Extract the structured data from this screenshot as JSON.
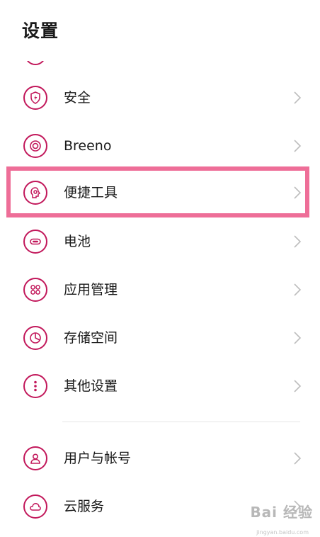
{
  "header": {
    "title": "设置"
  },
  "accent_color": "#c2185b",
  "highlight_color": "#ee6e98",
  "items": [
    {
      "label": "安全",
      "icon": "shield-icon"
    },
    {
      "label": "Breeno",
      "icon": "breeno-icon"
    },
    {
      "label": "便捷工具",
      "icon": "convenience-tools-icon"
    },
    {
      "label": "电池",
      "icon": "battery-icon"
    },
    {
      "label": "应用管理",
      "icon": "app-management-icon"
    },
    {
      "label": "存储空间",
      "icon": "storage-icon"
    },
    {
      "label": "其他设置",
      "icon": "more-settings-icon"
    },
    {
      "label": "用户与帐号",
      "icon": "user-account-icon"
    },
    {
      "label": "云服务",
      "icon": "cloud-icon"
    }
  ],
  "watermark": {
    "brand": "Bai 经验",
    "url": "jingyan.baidu.com"
  }
}
